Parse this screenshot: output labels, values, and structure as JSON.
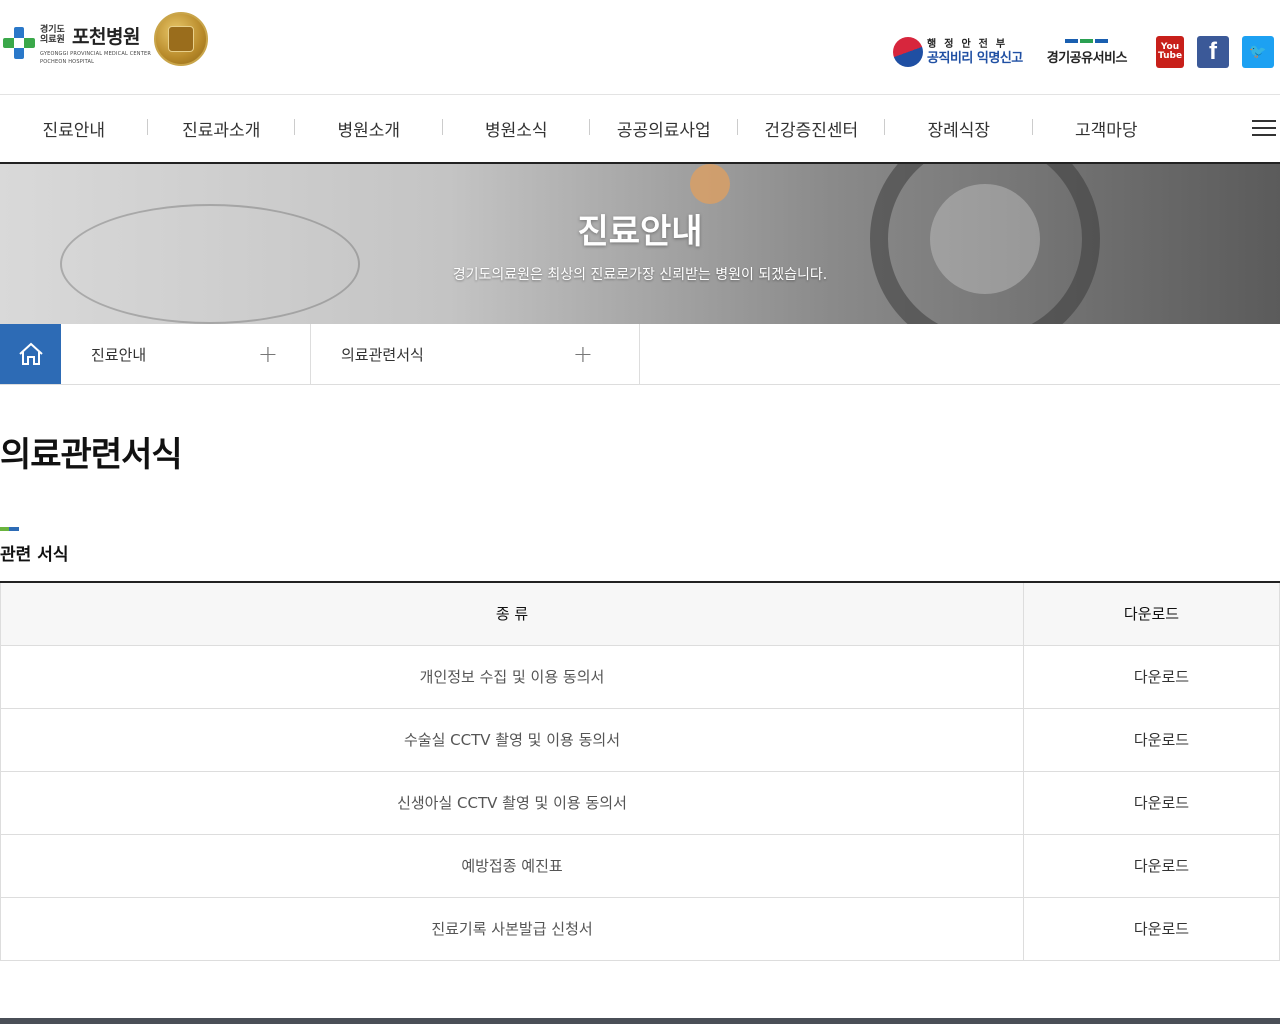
{
  "logo": {
    "small_line1": "경기도",
    "small_line2": "의료원",
    "name": "포천병원",
    "english_line1": "GYEONGGI PROVINCIAL MEDICAL CENTER",
    "english_line2": "POCHEON HOSPITAL"
  },
  "util": {
    "report_top": "행정안전부",
    "report_bottom": "공직비리 익명신고",
    "share": "경기공유서비스",
    "youtube_top": "You",
    "youtube_bottom": "Tube",
    "facebook": "f",
    "twitter": "🐦"
  },
  "gnb": {
    "items": [
      "진료안내",
      "진료과소개",
      "병원소개",
      "병원소식",
      "공공의료사업",
      "건강증진센터",
      "장례식장",
      "고객마당"
    ]
  },
  "visual": {
    "title": "진료안내",
    "subtitle": "경기도의료원은 최상의 진료로가장 신뢰받는 병원이 되겠습니다."
  },
  "location": {
    "depth1": "진료안내",
    "depth2": "의료관련서식",
    "plus": "+"
  },
  "content": {
    "page_title": "의료관련서식",
    "section_title": "관련 서식",
    "table": {
      "headers": [
        "종 류",
        "다운로드"
      ],
      "rows": [
        {
          "type": "개인정보 수집 및 이용 동의서",
          "download": "다운로드"
        },
        {
          "type": "수술실 CCTV 촬영 및 이용 동의서",
          "download": "다운로드"
        },
        {
          "type": "신생아실 CCTV 촬영 및 이용 동의서",
          "download": "다운로드"
        },
        {
          "type": "예방접종 예진표",
          "download": "다운로드"
        },
        {
          "type": "진료기록 사본발급 신청서",
          "download": "다운로드"
        }
      ]
    }
  },
  "colors": {
    "brand_blue": "#2d6bb5",
    "brand_green": "#6ab43e"
  }
}
